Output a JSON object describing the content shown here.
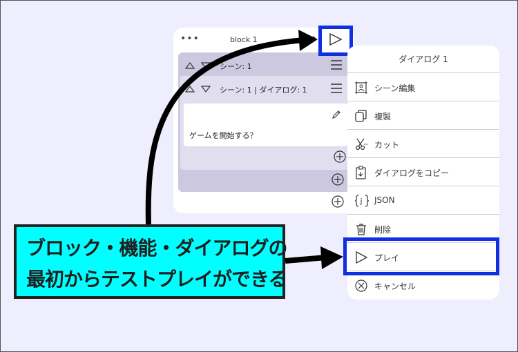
{
  "block_panel": {
    "dots": "•••",
    "title": "block 1",
    "scene_row_label": "シーン: 1",
    "dialog_row_label": "シーン: 1 | ダイアログ: 1",
    "dialog_text": "ゲームを開始する？"
  },
  "menu": {
    "title": "ダイアログ 1",
    "items": [
      {
        "label": "シーン編集",
        "icon": "scene-edit-icon"
      },
      {
        "label": "複製",
        "icon": "duplicate-icon"
      },
      {
        "label": "カット",
        "icon": "scissors-icon"
      },
      {
        "label": "ダイアログをコピー",
        "icon": "clipboard-icon"
      },
      {
        "label": "JSON",
        "icon": "json-braces-icon"
      },
      {
        "label": "削除",
        "icon": "trash-icon"
      },
      {
        "label": "プレイ",
        "icon": "play-icon"
      },
      {
        "label": "キャンセル",
        "icon": "cancel-icon"
      }
    ]
  },
  "callout": {
    "line1": "ブロック・機能・ダイアログの",
    "line2": "最初からテストプレイができる"
  },
  "colors": {
    "background": "#eeeefe",
    "highlight": "#1030e0",
    "callout_bg": "#00ffff",
    "scene_bg": "#ccc8e0",
    "dialog_bg": "#e1def0"
  }
}
